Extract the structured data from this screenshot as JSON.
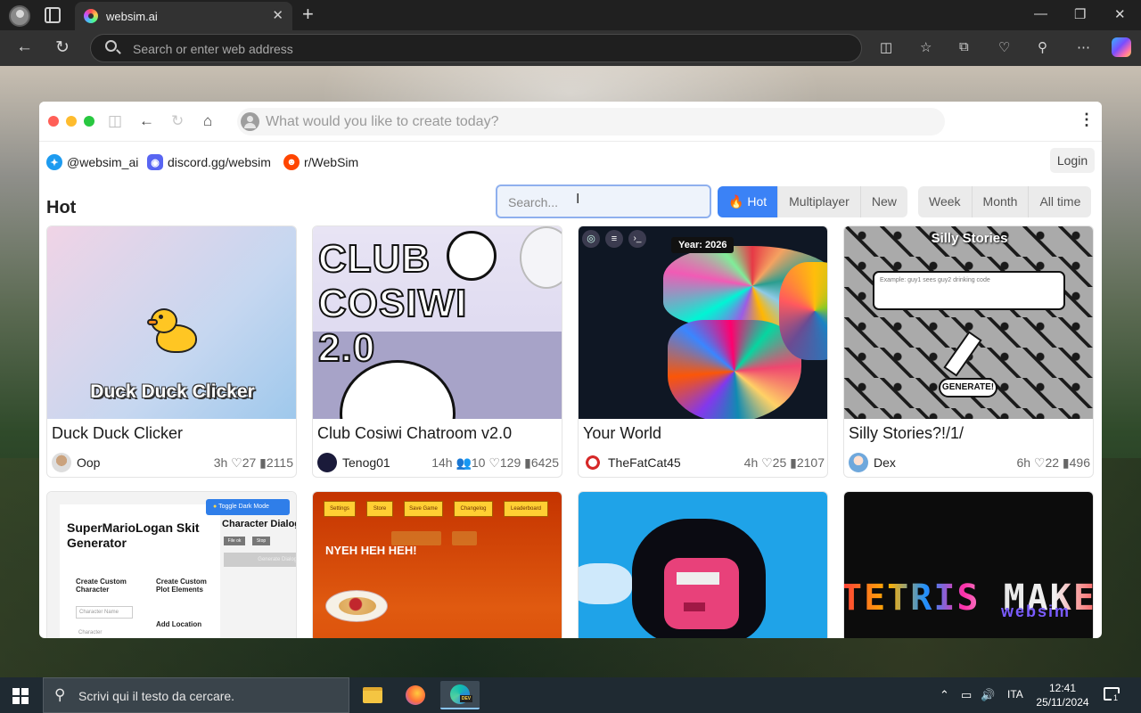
{
  "browser": {
    "tab_title": "websim.ai",
    "address_placeholder": "Search or enter web address"
  },
  "app": {
    "prompt_placeholder": "What would you like to create today?",
    "social": {
      "twitter": "@websim_ai",
      "discord": "discord.gg/websim",
      "reddit": "r/WebSim"
    },
    "login_label": "Login",
    "section_title": "Hot",
    "search_placeholder": "Search...",
    "sort_tabs": [
      {
        "label": "Hot",
        "active": true
      },
      {
        "label": "Multiplayer",
        "active": false
      },
      {
        "label": "New",
        "active": false
      }
    ],
    "time_tabs": [
      {
        "label": "Week"
      },
      {
        "label": "Month"
      },
      {
        "label": "All time"
      }
    ],
    "cards": [
      {
        "title": "Duck Duck Clicker",
        "author": "Oop",
        "stats": "3h ♡27 ▮2115",
        "thumb_text": "Duck Duck Clicker"
      },
      {
        "title": "Club Cosiwi Chatroom v2.0",
        "author": "Tenog01",
        "stats": "14h 👥10 ♡129 ▮6425",
        "thumb_text": "CLUB COSIWI 2.0"
      },
      {
        "title": "Your World",
        "author": "TheFatCat45",
        "stats": "4h ♡25 ▮2107",
        "thumb_text": "Year: 2026"
      },
      {
        "title": "Silly Stories?!/1/",
        "author": "Dex",
        "stats": "6h ♡22 ▮496",
        "thumb_text": "Silly Stories",
        "thumb_input": "Example: guy1 sees guy2 drinking code",
        "thumb_button": "GENERATE!"
      },
      {
        "thumb_title": "SuperMarioLogan Skit Generator",
        "thumb_heading": "Character Dialog",
        "thumb_toggle": "Toggle Dark Mode",
        "thumb_items": [
          "Create Custom Character",
          "Create Custom Plot Elements",
          "Add Location"
        ],
        "thumb_field": "Character Name",
        "thumb_field2": "Character",
        "thumb_buttons": [
          "File ok",
          "Stop",
          "Generate Dialog"
        ]
      },
      {
        "thumb_menu": [
          "Settings",
          "Store",
          "Save Game",
          "Changelog",
          "Leaderboard"
        ],
        "thumb_text": "NYEH HEH HEH!"
      },
      {},
      {
        "thumb_text": "TETRIS MAKER",
        "thumb_sub": "websim"
      }
    ]
  },
  "taskbar": {
    "search_text": "Scrivi qui il testo da cercare.",
    "language": "ITA",
    "time": "12:41",
    "date": "25/11/2024",
    "notification_count": "1"
  }
}
